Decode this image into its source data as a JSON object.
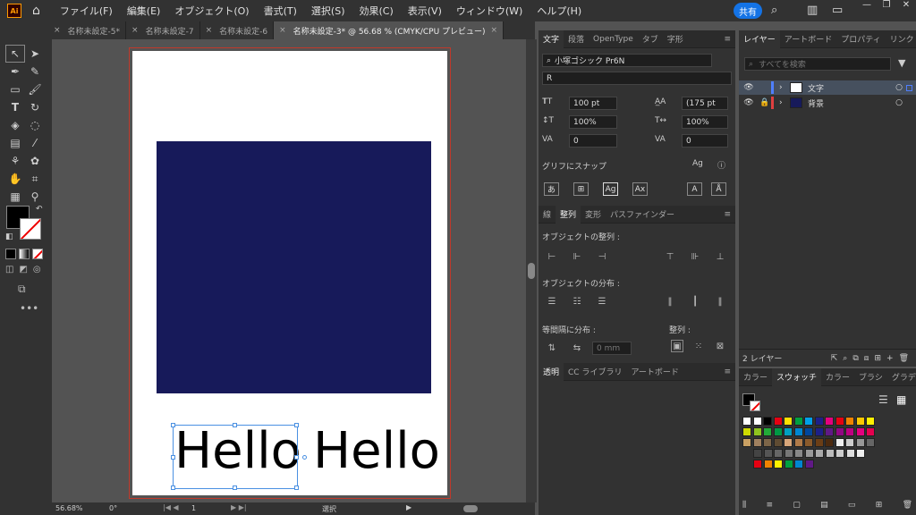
{
  "app": {
    "logo": "Ai"
  },
  "menu": [
    "ファイル(F)",
    "編集(E)",
    "オブジェクト(O)",
    "書式(T)",
    "選択(S)",
    "効果(C)",
    "表示(V)",
    "ウィンドウ(W)",
    "ヘルプ(H)"
  ],
  "share_label": "共有",
  "doc_tabs": [
    {
      "label": "名称未設定-5*",
      "close": "×"
    },
    {
      "label": "名称未設定-7",
      "close": "×"
    },
    {
      "label": "名称未設定-6",
      "close": "×"
    },
    {
      "label": "名称未設定-3* @ 56.68 % (CMYK/CPU プレビュー)",
      "close": "×"
    }
  ],
  "canvas": {
    "text1": "Hello",
    "text2": "Hello",
    "rect_color": "#171a5a"
  },
  "status": {
    "zoom": "56.68%",
    "rotation": "0°",
    "page": "1",
    "mode": "選択"
  },
  "char_panel": {
    "tabs": [
      "文字",
      "段落",
      "OpenType",
      "タブ",
      "字形"
    ],
    "font": "小塚ゴシック Pr6N",
    "style": "R",
    "size": "100 pt",
    "leading": "(175 pt",
    "vscale": "100%",
    "hscale": "100%",
    "kerning": "0",
    "tracking": "0",
    "glyph_snap": "グリフにスナップ"
  },
  "align_panel": {
    "tabs": [
      "線",
      "整列",
      "変形",
      "パスファインダー"
    ],
    "align_objects": "オブジェクトの整列 :",
    "distribute_objects": "オブジェクトの分布 :",
    "distribute_spacing": "等間隔に分布 :",
    "align_to": "整列 :",
    "spacing_value": "0 mm"
  },
  "transparency_panel": {
    "tabs": [
      "透明",
      "CC ライブラリ",
      "アートボード"
    ]
  },
  "layers_panel": {
    "tabs": [
      "レイヤー",
      "アートボード",
      "プロパティ",
      "リンク"
    ],
    "search_placeholder": "すべてを検索",
    "layers": [
      {
        "name": "文字",
        "color": "#4f7fff"
      },
      {
        "name": "背景",
        "color": "#e04040"
      }
    ],
    "count": "2 レイヤー"
  },
  "swatch_panel": {
    "tabs": [
      "カラー",
      "スウォッチ",
      "カラー",
      "ブラシ",
      "グラデ"
    ]
  }
}
